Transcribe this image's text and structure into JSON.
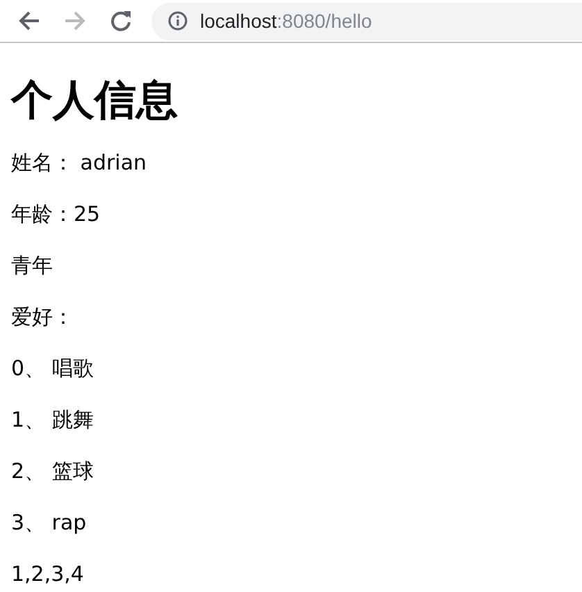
{
  "browser": {
    "back_disabled": false,
    "forward_disabled": true,
    "url_host": "localhost",
    "url_path": ":8080/hello"
  },
  "page": {
    "heading": "个人信息",
    "lines": [
      "姓名： adrian",
      "年龄：25",
      "青年",
      "爱好：",
      "0、 唱歌",
      "1、 跳舞",
      "2、 篮球",
      "3、 rap",
      "1,2,3,4"
    ]
  }
}
